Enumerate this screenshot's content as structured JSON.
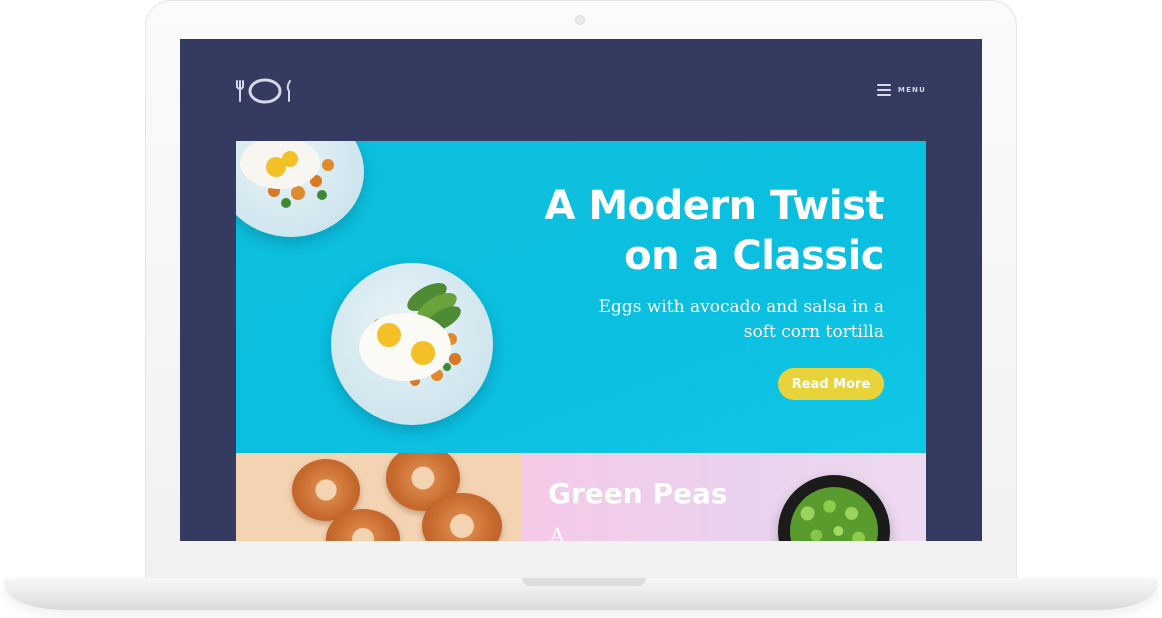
{
  "nav": {
    "logo_icon": "plate-and-cutlery-icon",
    "menu_icon": "hamburger-icon",
    "menu_label": "MENU"
  },
  "hero": {
    "title_line1": "A Modern Twist",
    "title_line2": "on a Classic",
    "subtitle_line1": "Eggs with avocado and salsa in a",
    "subtitle_line2": "soft corn tortilla",
    "cta_label": "Read More"
  },
  "cards": {
    "peas_title": "Green Peas",
    "peas_subtitle_partial": "A"
  },
  "colors": {
    "screen_background": "#343a60",
    "hero_background": "#0cc0dc",
    "cta_background": "#e9d33a",
    "peas_card_background": "#f0cfe9",
    "text_light": "#ffffff"
  }
}
